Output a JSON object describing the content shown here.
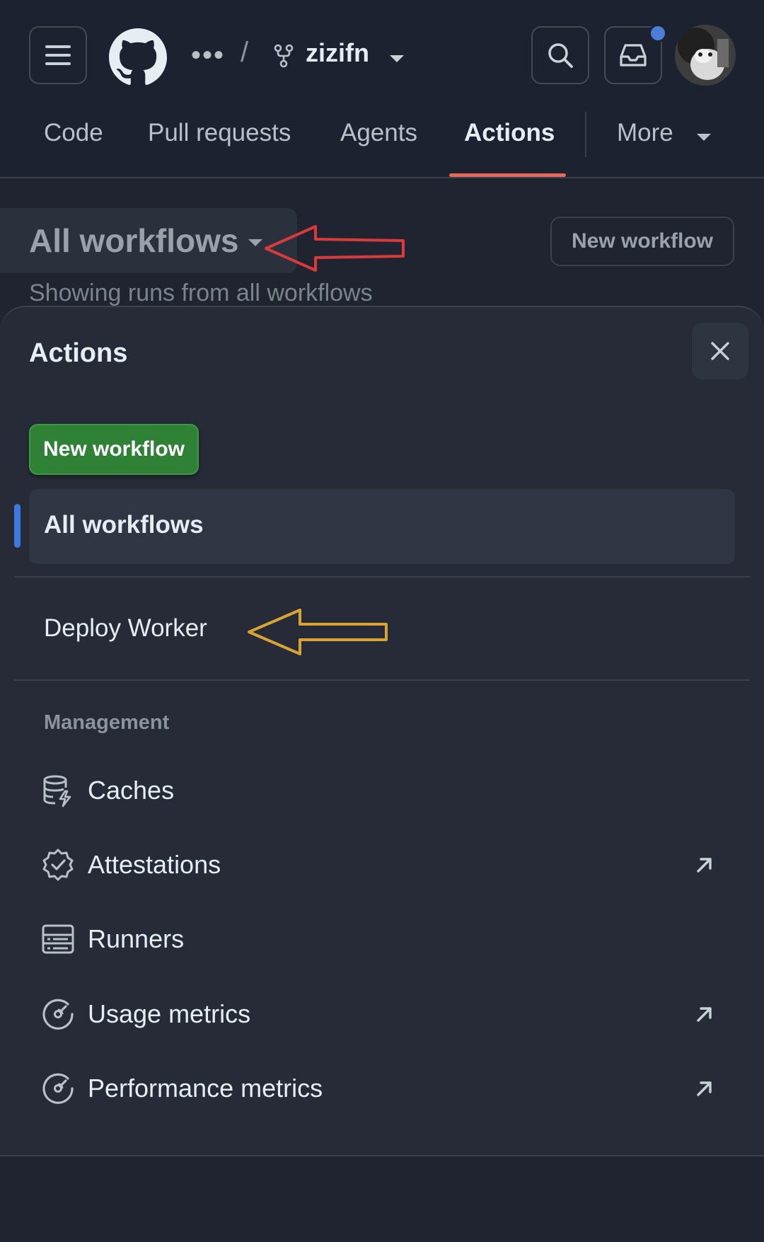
{
  "header": {
    "repo": {
      "ellipsis": "•••",
      "separator": "/",
      "name": "zizifn"
    },
    "tabs": [
      {
        "label": "Code"
      },
      {
        "label": "Pull requests"
      },
      {
        "label": "Agents"
      },
      {
        "label": "Actions"
      },
      {
        "label": "More"
      }
    ],
    "active_tab": "Actions",
    "notification_indicator_color": "#4b7fd6"
  },
  "background_page": {
    "title": "All workflows",
    "new_workflow_label": "New workflow",
    "subtitle": "Showing runs from all workflows"
  },
  "sheet": {
    "title": "Actions",
    "new_workflow_button": "New workflow",
    "workflows": [
      {
        "label": "All workflows",
        "selected": true
      },
      {
        "label": "Deploy Worker",
        "selected": false
      }
    ],
    "management_heading": "Management",
    "management_items": [
      {
        "label": "Caches",
        "icon": "database-icon",
        "external": false
      },
      {
        "label": "Attestations",
        "icon": "verified-badge-icon",
        "external": true
      },
      {
        "label": "Runners",
        "icon": "server-icon",
        "external": false
      },
      {
        "label": "Usage metrics",
        "icon": "meter-icon",
        "external": true
      },
      {
        "label": "Performance metrics",
        "icon": "meter-icon",
        "external": true
      }
    ]
  },
  "annotations": {
    "red_arrow_color": "#d93b3b",
    "yellow_arrow_color": "#d9a532"
  },
  "colors": {
    "background": "#1f2430",
    "sheet": "#262b37",
    "primary_button": "#2f8136",
    "selection_bar": "#3b7ae0",
    "tab_underline": "#e46b57"
  }
}
